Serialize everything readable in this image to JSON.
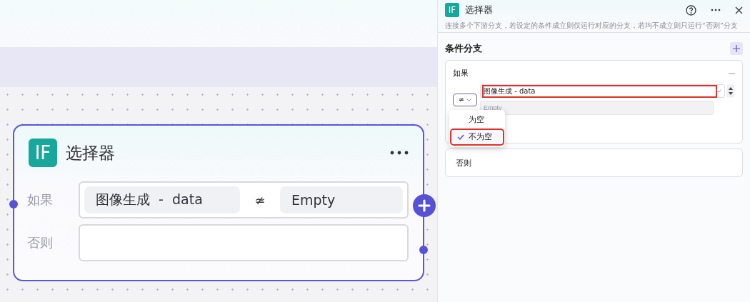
{
  "canvas": {
    "node": {
      "badge": "IF",
      "title": "选择器",
      "branches": [
        {
          "kind": "condition",
          "label": "如果",
          "left": "图像生成  -  data",
          "operator": "≄",
          "right": "Empty"
        },
        {
          "kind": "else",
          "label": "否则"
        }
      ]
    }
  },
  "panel": {
    "badge": "IF",
    "title": "选择器",
    "description": "连接多个下游分支，若设定的条件成立则仅运行对应的分支，若均不成立则只运行“否则”分支",
    "section_title": "条件分支",
    "condition_card": {
      "title": "如果",
      "operator": "≄",
      "field": {
        "value": "图像生成 - data",
        "highlighted": true
      },
      "value_field": {
        "placeholder": "Empty"
      },
      "dropdown": [
        {
          "label": "为空",
          "selected": false,
          "highlighted": false
        },
        {
          "label": "不为空",
          "selected": true,
          "highlighted": true
        }
      ]
    },
    "else_card": {
      "title": "否则"
    }
  }
}
